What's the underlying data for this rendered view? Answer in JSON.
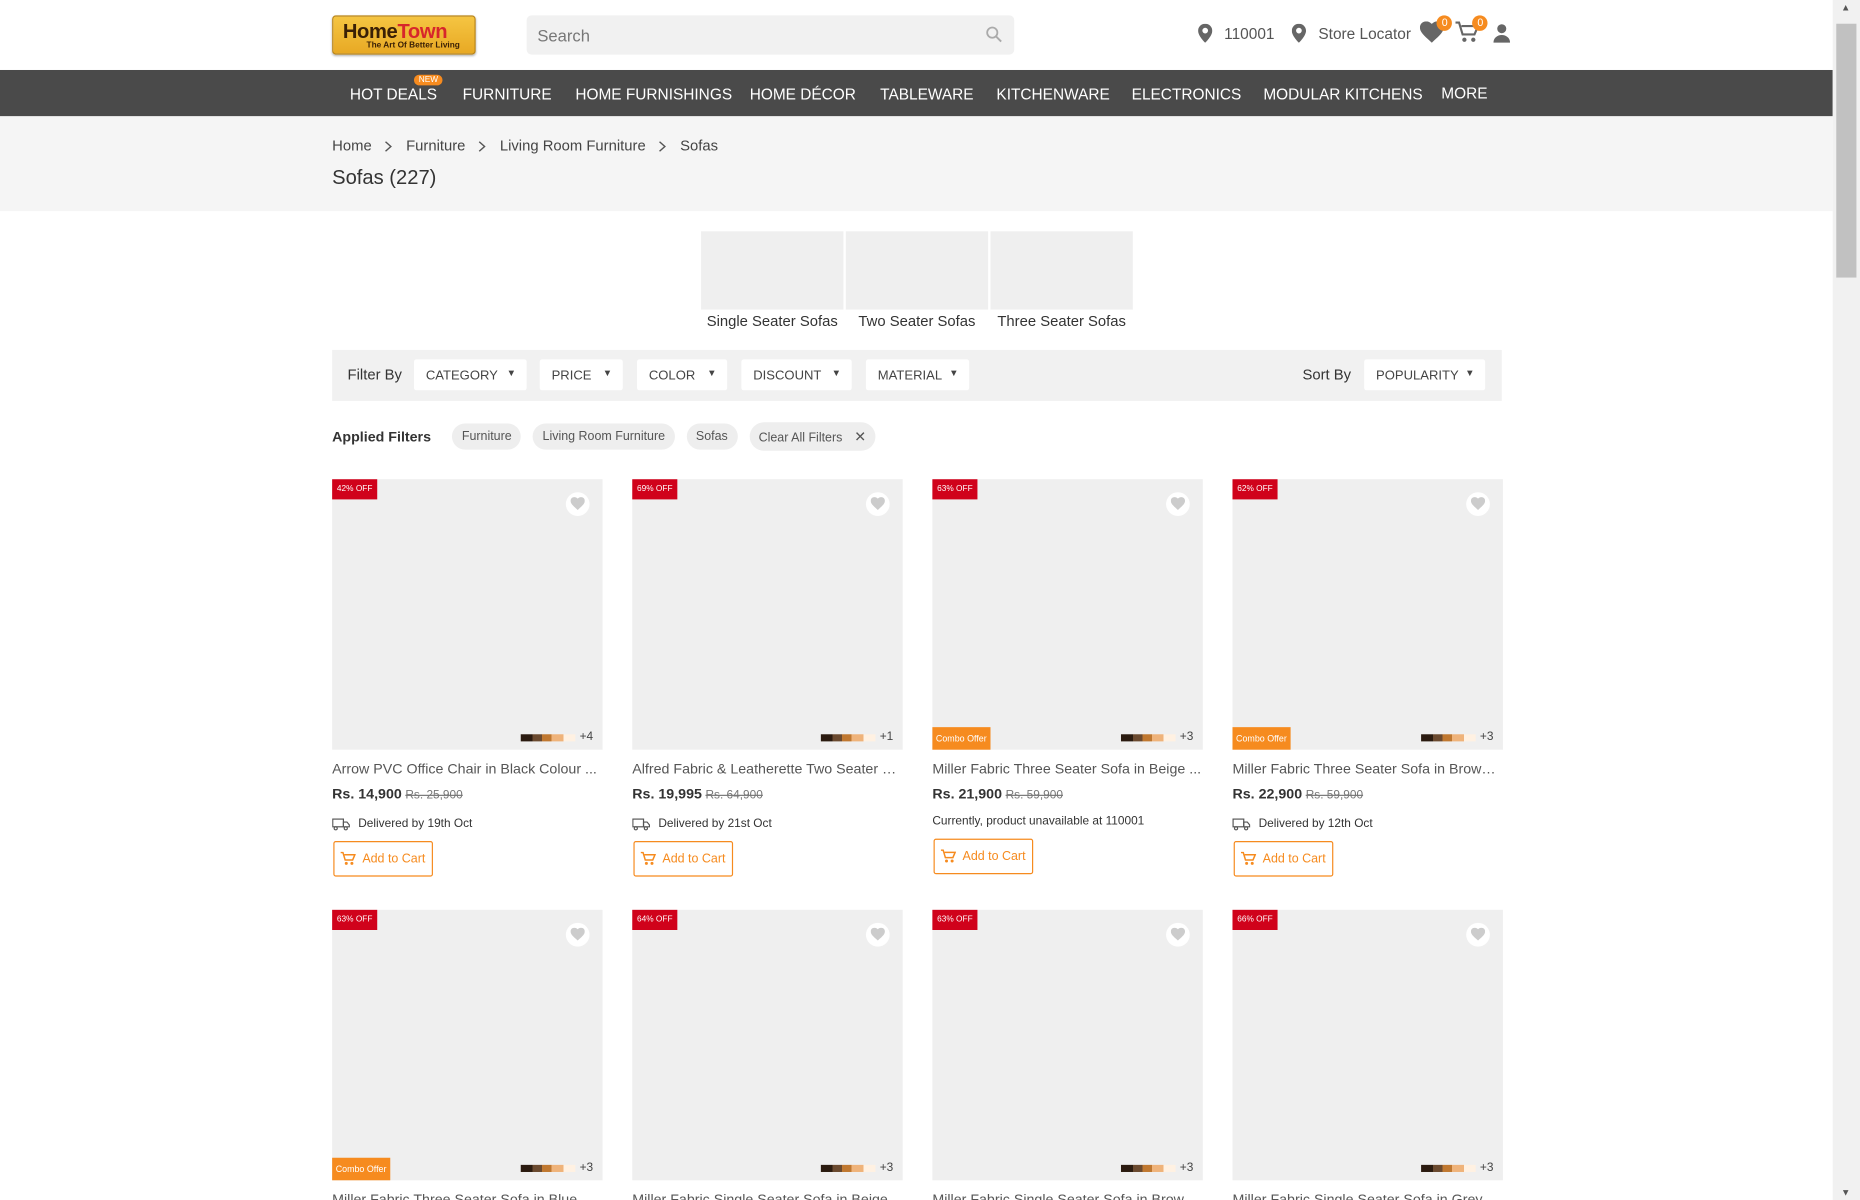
{
  "header": {
    "logo_main_a": "Home",
    "logo_main_b": "Town",
    "logo_tagline": "The Art Of Better Living",
    "search_placeholder": "Search",
    "pincode": "110001",
    "store_locator": "Store Locator",
    "wishlist_count": "0",
    "cart_count": "0"
  },
  "nav": {
    "items": [
      "HOT DEALS",
      "FURNITURE",
      "HOME FURNISHINGS",
      "HOME DÉCOR",
      "TABLEWARE",
      "KITCHENWARE",
      "ELECTRONICS",
      "MODULAR KITCHENS",
      "MORE"
    ],
    "new_badge": "NEW"
  },
  "breadcrumb": [
    "Home",
    "Furniture",
    "Living Room Furniture",
    "Sofas"
  ],
  "page_title": "Sofas (227)",
  "subcategories": [
    "Single Seater Sofas",
    "Two Seater Sofas",
    "Three Seater Sofas"
  ],
  "filters": {
    "label": "Filter By",
    "options": [
      "CATEGORY",
      "PRICE",
      "COLOR",
      "DISCOUNT",
      "MATERIAL"
    ],
    "sort_label": "Sort By",
    "sort_value": "POPULARITY"
  },
  "applied_filters": {
    "label": "Applied Filters",
    "chips": [
      "Furniture",
      "Living Room Furniture",
      "Sofas"
    ],
    "clear_label": "Clear All Filters"
  },
  "products": [
    {
      "discount": "42% OFF",
      "combo": "",
      "more": "+4",
      "name": "Arrow PVC Office Chair in Black Colour ...",
      "price": "Rs. 14,900",
      "mrp": "Rs. 25,900",
      "delivery": "Delivered by 19th Oct",
      "cta": "Add to Cart"
    },
    {
      "discount": "69% OFF",
      "combo": "",
      "more": "+1",
      "name": "Alfred Fabric & Leatherette Two Seater S...",
      "price": "Rs. 19,995",
      "mrp": "Rs. 64,900",
      "delivery": "Delivered by 21st Oct",
      "cta": "Add to Cart"
    },
    {
      "discount": "63% OFF",
      "combo": "Combo Offer",
      "more": "+3",
      "name": "Miller Fabric Three Seater Sofa in Beige ...",
      "price": "Rs. 21,900",
      "mrp": "Rs. 59,900",
      "unavailable": "Currently, product unavailable at 110001",
      "cta": "Add to Cart"
    },
    {
      "discount": "62% OFF",
      "combo": "Combo Offer",
      "more": "+3",
      "name": "Miller Fabric Three Seater Sofa in Brown ...",
      "price": "Rs. 22,900",
      "mrp": "Rs. 59,900",
      "delivery": "Delivered by 12th Oct",
      "cta": "Add to Cart"
    },
    {
      "discount": "63% OFF",
      "combo": "Combo Offer",
      "more": "+3",
      "name": "Miller Fabric Three Seater Sofa in Blue C..."
    },
    {
      "discount": "64% OFF",
      "combo": "",
      "more": "+3",
      "name": "Miller Fabric Single Seater Sofa in Beige ..."
    },
    {
      "discount": "63% OFF",
      "combo": "",
      "more": "+3",
      "name": "Miller Fabric Single Seater Sofa in Brown..."
    },
    {
      "discount": "66% OFF",
      "combo": "",
      "more": "+3",
      "name": "Miller Fabric Single Seater Sofa in Grey ..."
    }
  ],
  "colors": {
    "accent": "#f68b1f",
    "nav_bg": "#4a4a4a",
    "discount_bg": "#d0021b"
  }
}
